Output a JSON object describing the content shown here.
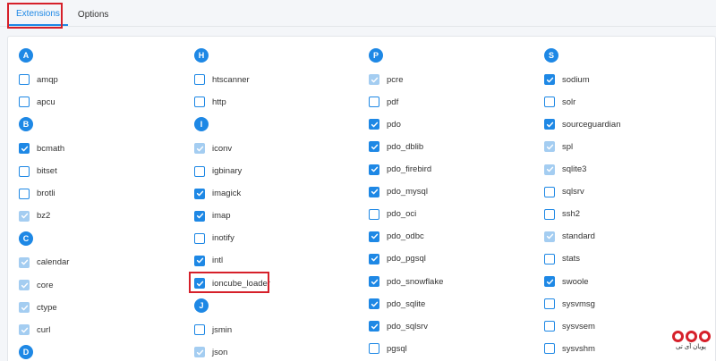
{
  "tabs": [
    {
      "label": "Extensions",
      "active": true
    },
    {
      "label": "Options",
      "active": false
    }
  ],
  "columns": [
    {
      "groups": [
        {
          "letter": "A",
          "items": [
            {
              "label": "amqp",
              "state": "unchecked"
            },
            {
              "label": "apcu",
              "state": "unchecked"
            }
          ]
        },
        {
          "letter": "B",
          "items": [
            {
              "label": "bcmath",
              "state": "checked"
            },
            {
              "label": "bitset",
              "state": "unchecked"
            },
            {
              "label": "brotli",
              "state": "unchecked"
            },
            {
              "label": "bz2",
              "state": "disabled"
            }
          ]
        },
        {
          "letter": "C",
          "items": [
            {
              "label": "calendar",
              "state": "disabled"
            },
            {
              "label": "core",
              "state": "disabled"
            },
            {
              "label": "ctype",
              "state": "disabled"
            },
            {
              "label": "curl",
              "state": "disabled"
            }
          ]
        },
        {
          "letter": "D",
          "items": []
        }
      ]
    },
    {
      "groups": [
        {
          "letter": "H",
          "items": [
            {
              "label": "htscanner",
              "state": "unchecked"
            },
            {
              "label": "http",
              "state": "unchecked"
            }
          ]
        },
        {
          "letter": "I",
          "items": [
            {
              "label": "iconv",
              "state": "disabled"
            },
            {
              "label": "igbinary",
              "state": "unchecked"
            },
            {
              "label": "imagick",
              "state": "checked"
            },
            {
              "label": "imap",
              "state": "checked"
            },
            {
              "label": "inotify",
              "state": "unchecked"
            },
            {
              "label": "intl",
              "state": "checked"
            },
            {
              "label": "ioncube_loader",
              "state": "checked",
              "highlighted": true
            }
          ]
        },
        {
          "letter": "J",
          "items": [
            {
              "label": "jsmin",
              "state": "unchecked"
            },
            {
              "label": "json",
              "state": "disabled"
            }
          ]
        }
      ]
    },
    {
      "groups": [
        {
          "letter": "P",
          "items": [
            {
              "label": "pcre",
              "state": "disabled"
            },
            {
              "label": "pdf",
              "state": "unchecked"
            },
            {
              "label": "pdo",
              "state": "checked"
            },
            {
              "label": "pdo_dblib",
              "state": "checked"
            },
            {
              "label": "pdo_firebird",
              "state": "checked"
            },
            {
              "label": "pdo_mysql",
              "state": "checked"
            },
            {
              "label": "pdo_oci",
              "state": "unchecked"
            },
            {
              "label": "pdo_odbc",
              "state": "checked"
            },
            {
              "label": "pdo_pgsql",
              "state": "checked"
            },
            {
              "label": "pdo_snowflake",
              "state": "checked"
            },
            {
              "label": "pdo_sqlite",
              "state": "checked"
            },
            {
              "label": "pdo_sqlsrv",
              "state": "checked"
            },
            {
              "label": "pgsql",
              "state": "unchecked"
            }
          ]
        }
      ]
    },
    {
      "groups": [
        {
          "letter": "S",
          "items": [
            {
              "label": "sodium",
              "state": "checked"
            },
            {
              "label": "solr",
              "state": "unchecked"
            },
            {
              "label": "sourceguardian",
              "state": "checked"
            },
            {
              "label": "spl",
              "state": "disabled"
            },
            {
              "label": "sqlite3",
              "state": "disabled"
            },
            {
              "label": "sqlsrv",
              "state": "unchecked"
            },
            {
              "label": "ssh2",
              "state": "unchecked"
            },
            {
              "label": "standard",
              "state": "disabled"
            },
            {
              "label": "stats",
              "state": "unchecked"
            },
            {
              "label": "swoole",
              "state": "checked"
            },
            {
              "label": "sysvmsg",
              "state": "unchecked"
            },
            {
              "label": "sysvsem",
              "state": "unchecked"
            },
            {
              "label": "sysvshm",
              "state": "unchecked"
            }
          ]
        }
      ]
    }
  ],
  "logo": {
    "text": "پویان آی تی"
  },
  "colors": {
    "accent": "#1e88e5",
    "disabled": "#a4cdf1",
    "highlight": "#d6202a"
  }
}
